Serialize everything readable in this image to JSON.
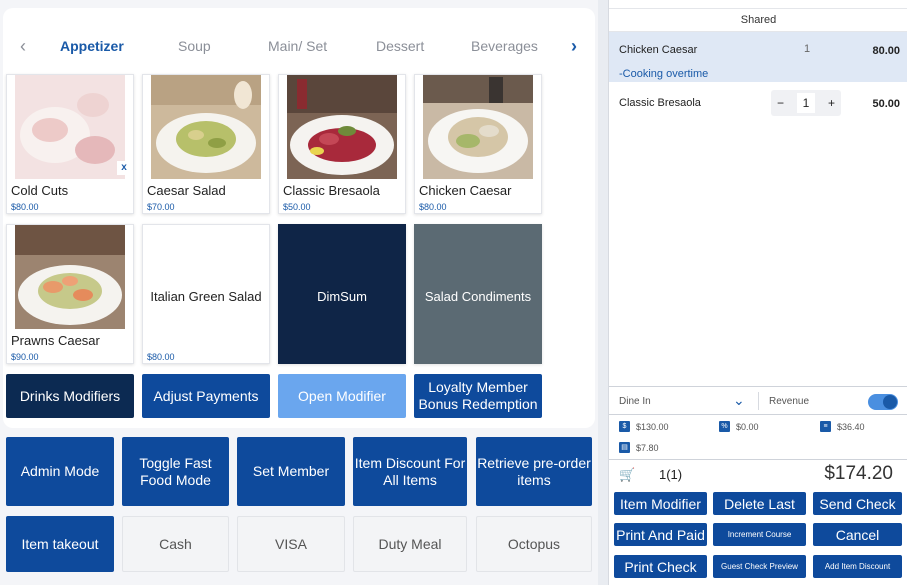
{
  "tabs": {
    "prev_arrow": "‹",
    "next_arrow": "›",
    "items": [
      "Appetizer",
      "Soup",
      "Main/ Set",
      "Dessert",
      "Beverages"
    ],
    "active": "Appetizer"
  },
  "menu_items": [
    {
      "name": "Cold Cuts",
      "price": "$80.00",
      "remove": "x"
    },
    {
      "name": "Caesar Salad",
      "price": "$70.00"
    },
    {
      "name": "Classic Bresaola",
      "price": "$50.00"
    },
    {
      "name": "Chicken Caesar",
      "price": "$80.00"
    },
    {
      "name": "Prawns Caesar",
      "price": "$90.00"
    },
    {
      "name": "Italian Green Salad",
      "price": "$80.00"
    },
    {
      "name": "DimSum"
    },
    {
      "name": "Salad Condiments"
    }
  ],
  "action_row": [
    "Drinks Modifiers",
    "Adjust Payments",
    "Open Modifier",
    "Loyalty Member Bonus Redemption"
  ],
  "bottom_grid": [
    "Admin Mode",
    "Toggle Fast Food Mode",
    "Set Member",
    "Item Discount For All Items",
    "Retrieve pre-order items",
    "Item takeout",
    "Cash",
    "VISA",
    "Duty Meal",
    "Octopus"
  ],
  "order": {
    "section": "Shared",
    "lines": [
      {
        "name": "Chicken Caesar",
        "qty": "1",
        "price": "80.00",
        "note": "-Cooking overtime"
      },
      {
        "name": "Classic Bresaola",
        "qty": "1",
        "price": "50.00",
        "minus": "−",
        "plus": "+"
      }
    ]
  },
  "footer": {
    "dine_mode": "Dine In",
    "revenue_label": "Revenue",
    "revenue_on": true,
    "summary": [
      {
        "icon": "$",
        "value": "$130.00"
      },
      {
        "icon": "%",
        "value": "$0.00"
      },
      {
        "icon": "≡",
        "value": "$36.40"
      },
      {
        "icon": "▤",
        "value": "$7.80"
      }
    ],
    "cart_count": "1(1)",
    "total": "$174.20"
  },
  "right_buttons": [
    "Item Modifier",
    "Delete Last",
    "Send Check",
    "Print And Paid",
    "Increment Course",
    "Cancel",
    "Print Check",
    "Guest Check Preview",
    "Add Item Discount"
  ],
  "colors": {
    "accent": "#1a5aa8",
    "button": "#0e4a9c",
    "dark_tile": "#0f2547",
    "slate_tile": "#5b6a73",
    "light_button": "#6aa6ee"
  }
}
